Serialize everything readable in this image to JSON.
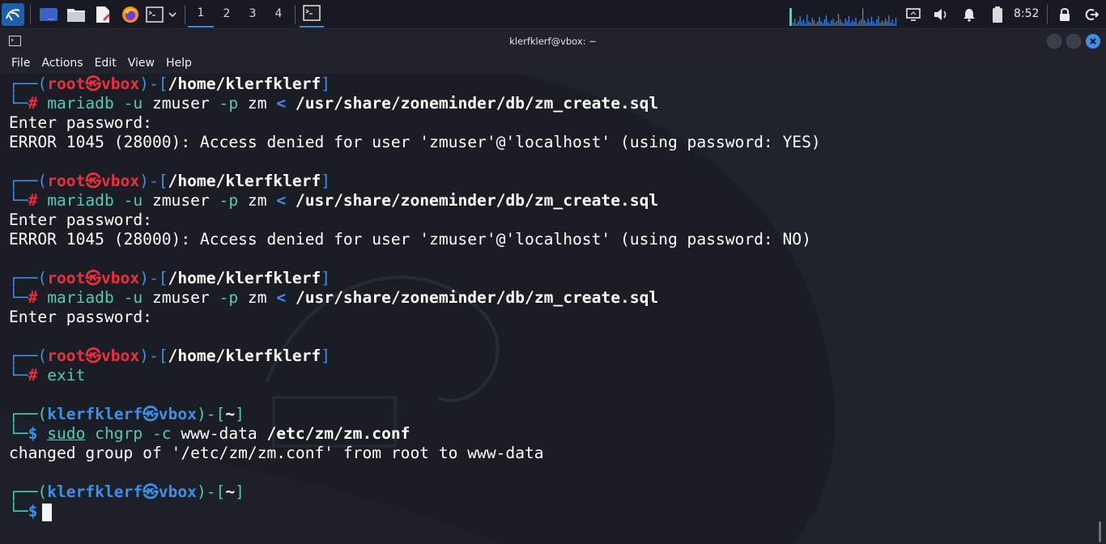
{
  "panel": {
    "workspaces": [
      "1",
      "2",
      "3",
      "4"
    ],
    "active_workspace": "1",
    "clock": "8:52"
  },
  "window": {
    "title": "klerfklerf@vbox: ~",
    "menu": [
      "File",
      "Actions",
      "Edit",
      "View",
      "Help"
    ]
  },
  "terminal": {
    "blocks": [
      {
        "user": "root",
        "host": "vbox",
        "cwd": "/home/klerfklerf",
        "sym": "#",
        "cmd": "mariadb",
        "opts": "-u",
        "arg1": "zmuser",
        "opt2": "-p",
        "arg2": "zm",
        "redir": "<",
        "file": "/usr/share/zoneminder/db/zm_create.sql",
        "out1": "Enter password:",
        "out2": "ERROR 1045 (28000): Access denied for user 'zmuser'@'localhost' (using password: YES)"
      },
      {
        "user": "root",
        "host": "vbox",
        "cwd": "/home/klerfklerf",
        "sym": "#",
        "cmd": "mariadb",
        "opts": "-u",
        "arg1": "zmuser",
        "opt2": "-p",
        "arg2": "zm",
        "redir": "<",
        "file": "/usr/share/zoneminder/db/zm_create.sql",
        "out1": "Enter password:",
        "out2": "ERROR 1045 (28000): Access denied for user 'zmuser'@'localhost' (using password: NO)"
      },
      {
        "user": "root",
        "host": "vbox",
        "cwd": "/home/klerfklerf",
        "sym": "#",
        "cmd": "mariadb",
        "opts": "-u",
        "arg1": "zmuser",
        "opt2": "-p",
        "arg2": "zm",
        "redir": "<",
        "file": "/usr/share/zoneminder/db/zm_create.sql",
        "out1": "Enter password:"
      },
      {
        "user": "root",
        "host": "vbox",
        "cwd": "/home/klerfklerf",
        "sym": "#",
        "cmd": "exit"
      },
      {
        "user": "klerfklerf",
        "host": "vbox",
        "cwd": "~",
        "sym": "$",
        "cmd": "sudo",
        "cmd2": "chgrp",
        "opts": "-c",
        "arg1": "www-data",
        "file": "/etc/zm/zm.conf",
        "out1": "changed group of '/etc/zm/zm.conf' from root to www-data"
      },
      {
        "user": "klerfklerf",
        "host": "vbox",
        "cwd": "~",
        "sym": "$"
      }
    ]
  },
  "colors": {
    "prompt_frame": "#3f8fe8",
    "root_user": "#ec2e3e",
    "normal_user": "#3f8fe8",
    "command": "#4ecdb4",
    "background": "#1a1d24"
  }
}
